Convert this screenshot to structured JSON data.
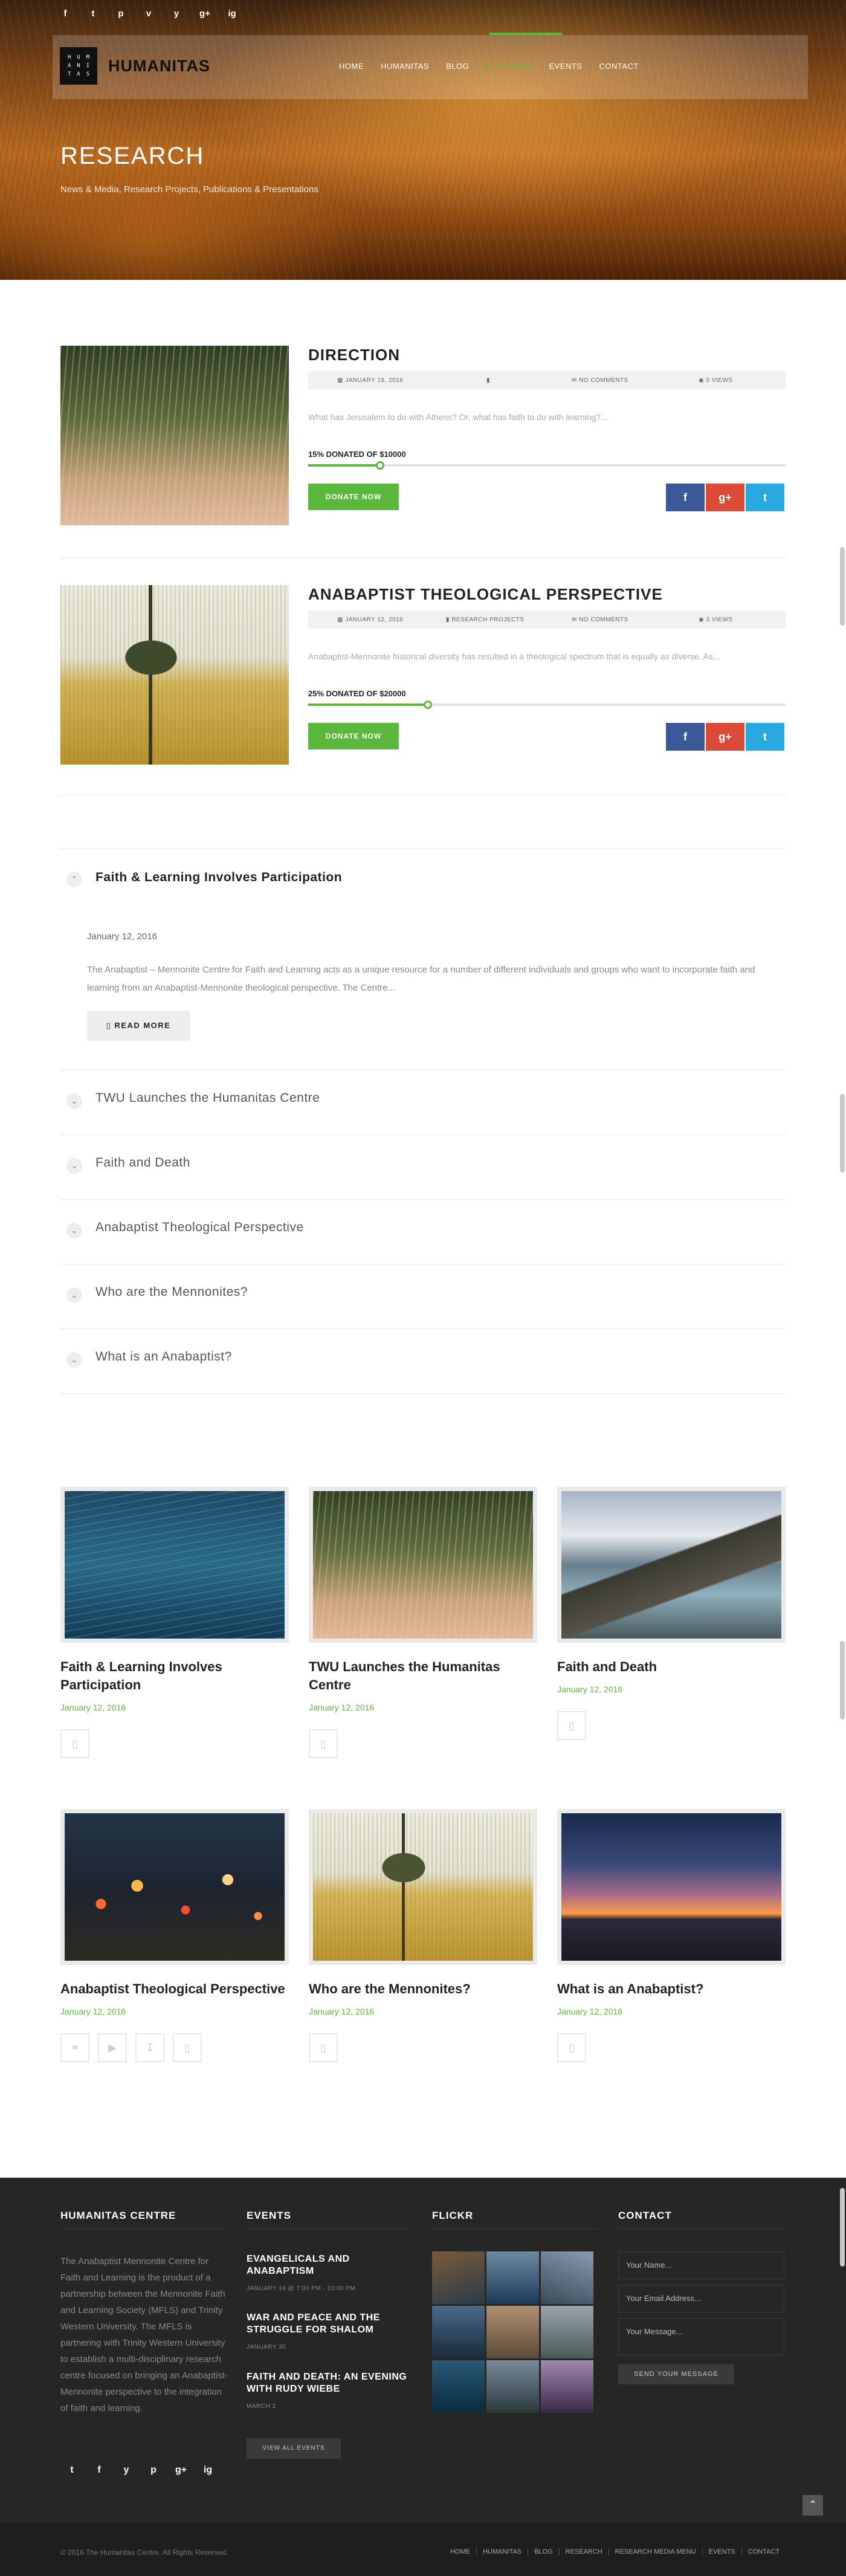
{
  "header": {
    "social": [
      "f",
      "t",
      "p",
      "v",
      "y",
      "g+",
      "ig"
    ],
    "logo_letters": [
      "H",
      "U",
      "M",
      "A",
      "N",
      "I",
      "T",
      "A",
      "S"
    ],
    "logo_text": "HUMANITAS",
    "nav": [
      "HOME",
      "HUMANITAS",
      "BLOG",
      "RESEARCH",
      "EVENTS",
      "CONTACT"
    ]
  },
  "hero": {
    "title": "RESEARCH",
    "subtitle": "News & Media, Research Projects, Publications & Presentations"
  },
  "projects": [
    {
      "title": "DIRECTION",
      "date": "JANUARY 19, 2016",
      "category": "",
      "comments": "NO COMMENTS",
      "views": "0 VIEWS",
      "excerpt": "What has Jerusalem to do with Athens? Or, what has faith to do with learning?...",
      "donated": "15% DONATED OF $10000",
      "progress": 15,
      "donate_label": "DONATE NOW"
    },
    {
      "title": "ANABAPTIST THEOLOGICAL PERSPECTIVE",
      "date": "JANUARY 12, 2016",
      "category": "RESEARCH PROJECTS",
      "comments": "NO COMMENTS",
      "views": "3 VIEWS",
      "excerpt": "Anabaptist-Mennonite historical diversity has resulted in a theological spectrum that is equally as diverse. As...",
      "donated": "25% DONATED OF $20000",
      "progress": 25,
      "donate_label": "DONATE NOW"
    }
  ],
  "share": {
    "facebook": "f",
    "googleplus": "g+",
    "twitter": "t"
  },
  "accordion": {
    "open": {
      "title": "Faith & Learning Involves Participation",
      "date": "January 12, 2016",
      "text": "The Anabaptist – Mennonite Centre for Faith and Learning acts as a unique resource for a number of different individuals and groups who want to incorporate faith and learning from an Anabaptist-Mennonite theological perspective. The Centre...",
      "read_more": "READ MORE"
    },
    "items": [
      "TWU Launches the Humanitas Centre",
      "Faith and Death",
      "Anabaptist Theological Perspective",
      "Who are the Mennonites?",
      "What is an Anabaptist?"
    ]
  },
  "posts": [
    {
      "title": "Faith & Learning Involves Participation",
      "date": "January 12, 2016"
    },
    {
      "title": "TWU Launches the Humanitas Centre",
      "date": "January 12, 2016"
    },
    {
      "title": "Faith and Death",
      "date": "January 12, 2016"
    },
    {
      "title": "Anabaptist Theological Perspective",
      "date": "January 12, 2016"
    },
    {
      "title": "Who are the Mennonites?",
      "date": "January 12, 2016"
    },
    {
      "title": "What is an Anabaptist?",
      "date": "January 12, 2016"
    }
  ],
  "footer": {
    "about_heading": "HUMANITAS CENTRE",
    "about_text": "The Anabaptist Mennonite Centre for Faith and Learning is the product of a partnership between the Mennonite Faith and Learning Society (MFLS) and Trinity Western University. The MFLS is partnering with Trinity Western University to establish a multi-disciplinary research centre focused on bringing an Anabaptist-Mennonite perspective to the integration of faith and learning.",
    "events_heading": "EVENTS",
    "events": [
      {
        "title": "EVANGELICALS AND ANABAPTISM",
        "date": "JANUARY 19 @ 7:00 PM - 10:00 PM"
      },
      {
        "title": "WAR AND PEACE AND THE STRUGGLE FOR SHALOM",
        "date": "JANUARY 30"
      },
      {
        "title": "FAITH AND DEATH: AN EVENING WITH RUDY WIEBE",
        "date": "MARCH 2"
      }
    ],
    "view_all": "VIEW ALL EVENTS",
    "flickr_heading": "FLICKR",
    "contact_heading": "CONTACT",
    "name_placeholder": "Your Name...",
    "email_placeholder": "Your Email Address...",
    "message_placeholder": "Your Message...",
    "send_label": "SEND YOUR MESSAGE",
    "social": [
      "t",
      "f",
      "y",
      "p",
      "g+",
      "ig"
    ]
  },
  "bottom": {
    "copyright": "© 2016 The Humanitas Centre. All Rights Reserved.",
    "nav": [
      "HOME",
      "HUMANITAS",
      "BLOG",
      "RESEARCH",
      "RESEARCH MEDIA MENU",
      "EVENTS",
      "CONTACT"
    ]
  },
  "colors": {
    "accent": "#5cb83d",
    "footer_bg": "#262626"
  }
}
